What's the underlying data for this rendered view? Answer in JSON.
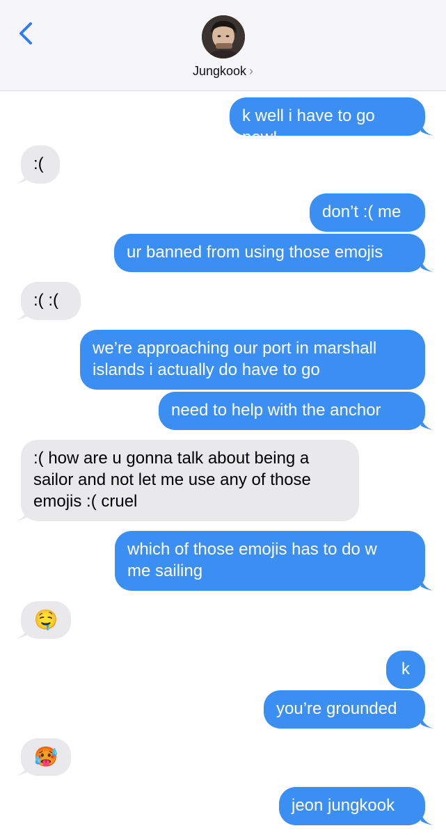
{
  "header": {
    "back_icon": "chevron-left-icon",
    "contact_name": "Jungkook",
    "chevron": "›",
    "accent": "#2f7cf6"
  },
  "colors": {
    "sent": "#3b8ff2",
    "received": "#e9e9eb"
  },
  "messages": [
    {
      "side": "sent",
      "text": "k well i have to go now!"
    },
    {
      "side": "received",
      "text": ":("
    },
    {
      "side": "sent",
      "text": "don’t :( me"
    },
    {
      "side": "sent",
      "text": "ur banned from using those emojis"
    },
    {
      "side": "received",
      "text": ":( :("
    },
    {
      "side": "sent",
      "text": "we’re approaching our port in marshall\nislands i actually do have to go"
    },
    {
      "side": "sent",
      "text": "need to help with the anchor"
    },
    {
      "side": "received",
      "text": ":( how are u gonna talk about being a\nsailor and not let me use any of those\nemojis :( cruel"
    },
    {
      "side": "sent",
      "text": "which of those emojis has to do w\nme sailing"
    },
    {
      "side": "received",
      "text": "🤤"
    },
    {
      "side": "sent",
      "text": "k"
    },
    {
      "side": "sent",
      "text": "you’re grounded"
    },
    {
      "side": "received",
      "text": "🥵"
    },
    {
      "side": "sent",
      "text": "jeon jungkook"
    }
  ]
}
